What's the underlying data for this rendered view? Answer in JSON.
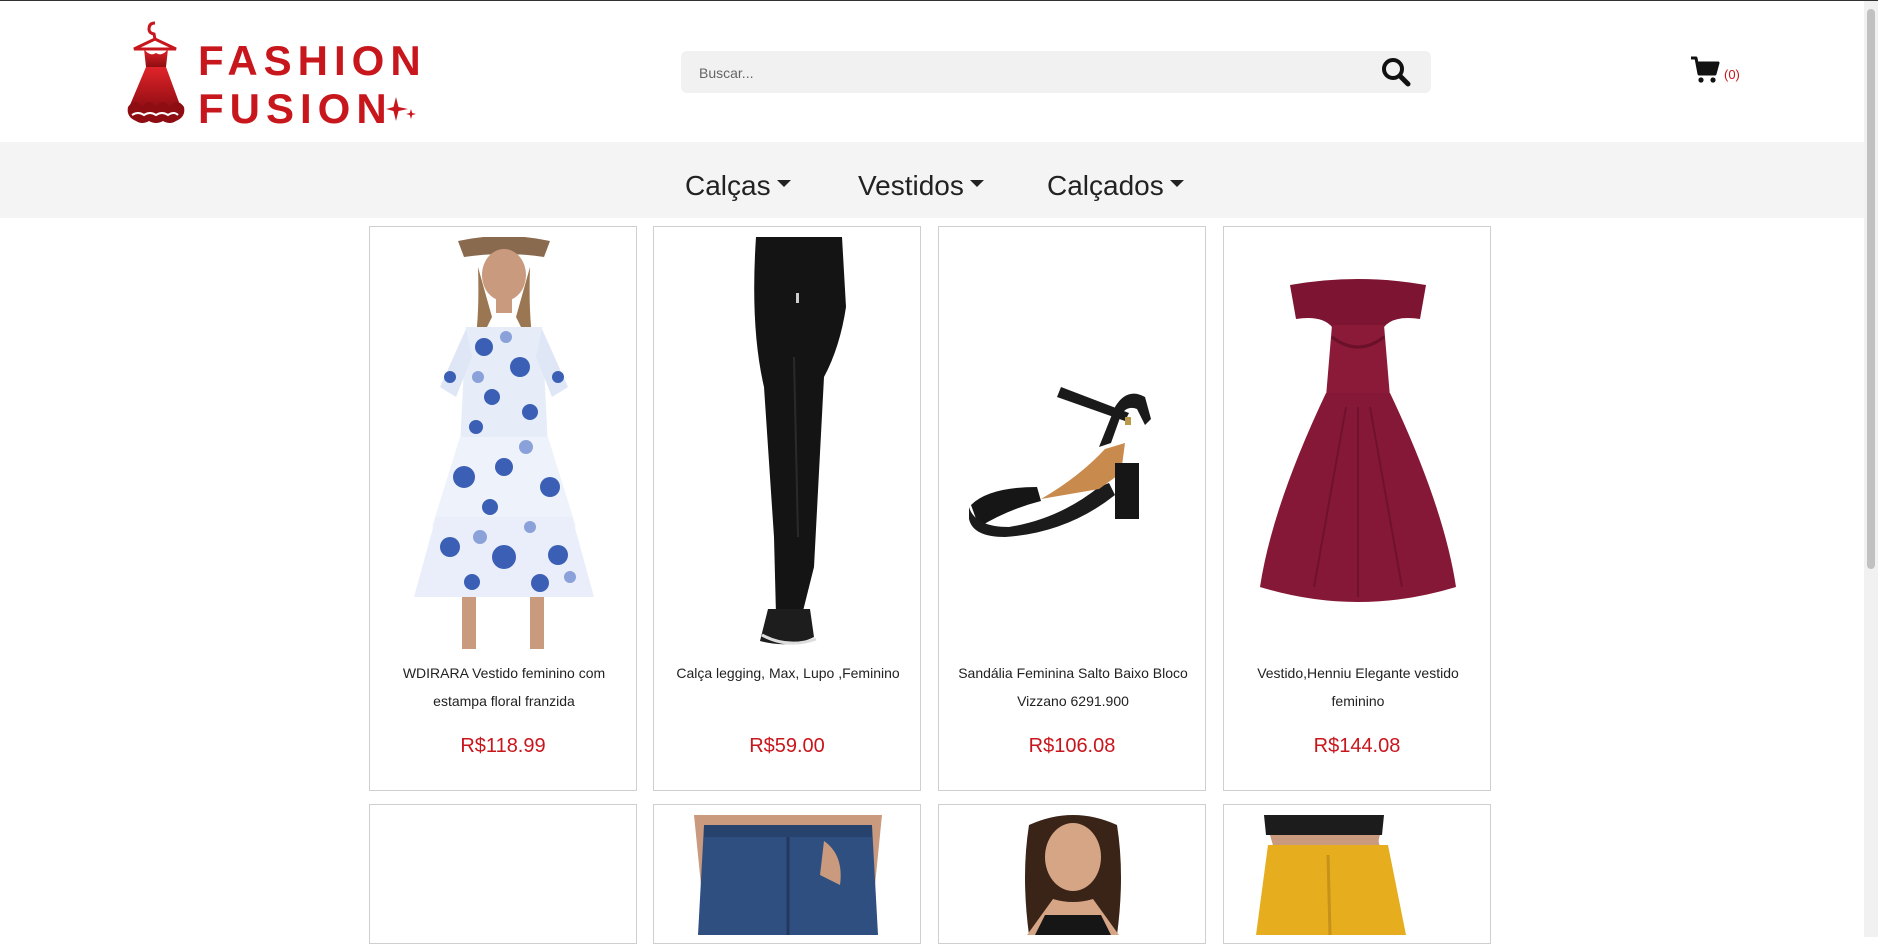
{
  "brand": {
    "line1": "FASHION",
    "line2": "FUSION",
    "color": "#c8161d"
  },
  "search": {
    "placeholder": "Buscar...",
    "icon": "search-icon"
  },
  "cart": {
    "icon": "shopping-cart-icon",
    "count_label": "(0)"
  },
  "nav": {
    "items": [
      {
        "label": "Calças"
      },
      {
        "label": "Vestidos"
      },
      {
        "label": "Calçados"
      }
    ]
  },
  "products": [
    {
      "title": "WDIRARA Vestido feminino com estampa floral franzida",
      "price": "R$118.99"
    },
    {
      "title": "Calça legging, Max, Lupo ,Feminino",
      "price": "R$59.00"
    },
    {
      "title": "Sandália Feminina Salto Baixo Bloco Vizzano 6291.900",
      "price": "R$106.08"
    },
    {
      "title": "Vestido,Henniu Elegante vestido feminino",
      "price": "R$144.08"
    }
  ],
  "colors": {
    "accent": "#c8161d",
    "nav_bg": "#f4f4f4",
    "search_bg": "#f1f1f1"
  }
}
